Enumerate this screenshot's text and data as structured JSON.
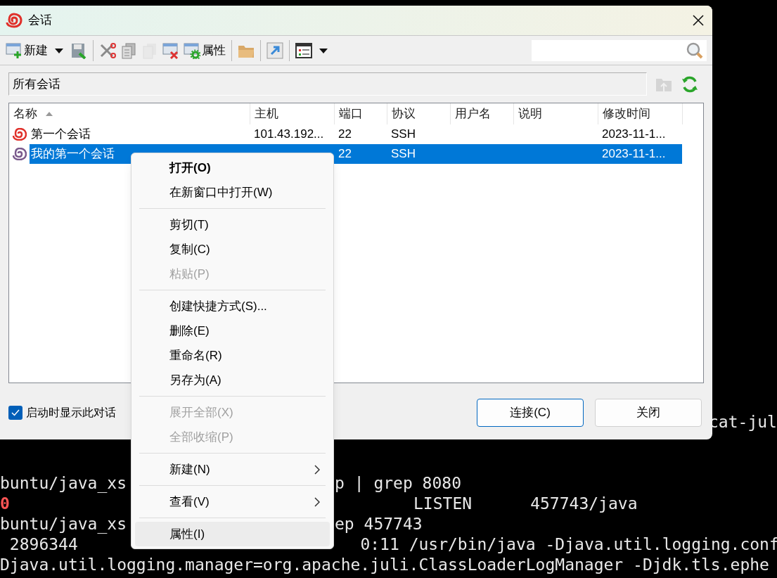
{
  "window": {
    "title": "会话"
  },
  "toolbar": [
    {
      "kind": "new",
      "label": "新建",
      "disabled": false
    },
    {
      "kind": "caret",
      "disabled": false
    },
    {
      "kind": "save",
      "disabled": false
    },
    {
      "kind": "separator"
    },
    {
      "kind": "cut",
      "disabled": false
    },
    {
      "kind": "copy",
      "disabled": false
    },
    {
      "kind": "paste",
      "disabled": true
    },
    {
      "kind": "delete",
      "disabled": false
    },
    {
      "kind": "properties",
      "label": "属性",
      "disabled": false
    },
    {
      "kind": "separator"
    },
    {
      "kind": "folder",
      "disabled": false
    },
    {
      "kind": "separator"
    },
    {
      "kind": "shortcut",
      "disabled": false
    },
    {
      "kind": "separator"
    },
    {
      "kind": "view",
      "disabled": false
    },
    {
      "kind": "caret",
      "disabled": false
    }
  ],
  "path": {
    "value": "所有会话"
  },
  "table": {
    "columns": [
      {
        "label": "名称",
        "sorted": true
      },
      {
        "label": "主机",
        "sorted": false
      },
      {
        "label": "端口",
        "sorted": false
      },
      {
        "label": "协议",
        "sorted": false
      },
      {
        "label": "用户名",
        "sorted": false
      },
      {
        "label": "说明",
        "sorted": false
      },
      {
        "label": "修改时间",
        "sorted": false
      }
    ],
    "rows": [
      {
        "name": "第一个会话",
        "host": "101.43.192...",
        "port": "22",
        "protocol": "SSH",
        "modified": "2023-11-1...",
        "color": "#e0302a",
        "selected": false
      },
      {
        "name": "我的第一个会话",
        "port": "22",
        "protocol": "SSH",
        "modified": "2023-11-1...",
        "color": "#7a5a8c",
        "selected": true
      }
    ]
  },
  "show_on_startup": {
    "label": "启动时显示此对话",
    "checked": true
  },
  "buttons": [
    {
      "label": "连接(C)",
      "default": true
    },
    {
      "label": "关闭",
      "default": false
    }
  ],
  "context_menu": [
    {
      "kind": "item",
      "label": "打开(O)",
      "default": true,
      "disabled": false,
      "submenu": false,
      "hovered": false
    },
    {
      "kind": "item",
      "label": "在新窗口中打开(W)",
      "default": false,
      "disabled": false,
      "submenu": false,
      "hovered": false
    },
    {
      "kind": "separator"
    },
    {
      "kind": "item",
      "label": "剪切(T)",
      "default": false,
      "disabled": false,
      "submenu": false,
      "hovered": false
    },
    {
      "kind": "item",
      "label": "复制(C)",
      "default": false,
      "disabled": false,
      "submenu": false,
      "hovered": false
    },
    {
      "kind": "item",
      "label": "粘贴(P)",
      "default": false,
      "disabled": true,
      "submenu": false,
      "hovered": false
    },
    {
      "kind": "separator"
    },
    {
      "kind": "item",
      "label": "创建快捷方式(S)...",
      "default": false,
      "disabled": false,
      "submenu": false,
      "hovered": false
    },
    {
      "kind": "item",
      "label": "删除(E)",
      "default": false,
      "disabled": false,
      "submenu": false,
      "hovered": false
    },
    {
      "kind": "item",
      "label": "重命名(R)",
      "default": false,
      "disabled": false,
      "submenu": false,
      "hovered": false
    },
    {
      "kind": "item",
      "label": "另存为(A)",
      "default": false,
      "disabled": false,
      "submenu": false,
      "hovered": false
    },
    {
      "kind": "separator"
    },
    {
      "kind": "item",
      "label": "展开全部(X)",
      "default": false,
      "disabled": true,
      "submenu": false,
      "hovered": false
    },
    {
      "kind": "item",
      "label": "全部收缩(P)",
      "default": false,
      "disabled": true,
      "submenu": false,
      "hovered": false
    },
    {
      "kind": "separator"
    },
    {
      "kind": "item",
      "label": "新建(N)",
      "default": false,
      "disabled": false,
      "submenu": true,
      "hovered": false
    },
    {
      "kind": "separator"
    },
    {
      "kind": "item",
      "label": "查看(V)",
      "default": false,
      "disabled": false,
      "submenu": true,
      "hovered": false
    },
    {
      "kind": "separator"
    },
    {
      "kind": "item",
      "label": "属性(I)",
      "default": false,
      "disabled": false,
      "submenu": false,
      "hovered": true
    }
  ],
  "terminal": [
    {
      "segments": [
        {
          "text": "cat-jul",
          "color": "#e8e8e8"
        }
      ]
    },
    {
      "segments": [
        {
          "text": "buntu/java_xs",
          "color": "#e8e8e8"
        },
        {
          "text": "p | grep 8080",
          "color": "#e8e8e8"
        }
      ]
    },
    {
      "segments": [
        {
          "text": "0",
          "color": "#ff5555"
        },
        {
          "text": "LISTEN      457743/java",
          "color": "#e8e8e8"
        }
      ]
    },
    {
      "segments": [
        {
          "text": "buntu/java_xs",
          "color": "#e8e8e8"
        },
        {
          "text": "ep 457743",
          "color": "#e8e8e8"
        }
      ]
    },
    {
      "segments": [
        {
          "text": " 2896344",
          "color": "#e8e8e8"
        },
        {
          "text": "0:11 /usr/bin/java -Djava.util.logging.conf",
          "color": "#e8e8e8"
        }
      ]
    },
    {
      "segments": [
        {
          "text": "Djava.util.logging.manager=org.apache.juli.ClassLoaderLogManager -Djdk.tls.ephe",
          "color": "#e8e8e8"
        }
      ]
    }
  ]
}
